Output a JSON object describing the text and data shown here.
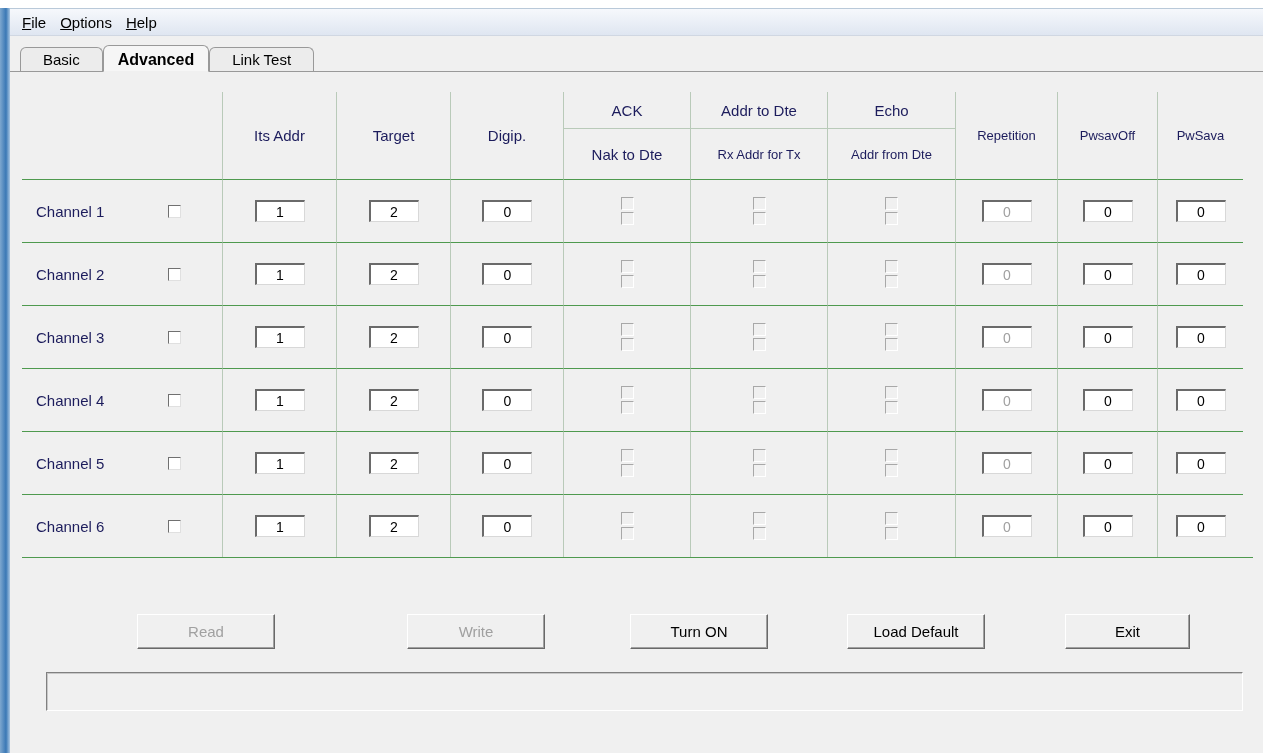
{
  "menu": [
    {
      "label": "File"
    },
    {
      "label": "Options"
    },
    {
      "label": "Help"
    }
  ],
  "tabs": [
    {
      "label": "Basic",
      "selected": false
    },
    {
      "label": "Advanced",
      "selected": true
    },
    {
      "label": "Link Test",
      "selected": false
    }
  ],
  "columns": [
    {
      "kind": "field",
      "label": "Its Addr",
      "disabled": false
    },
    {
      "kind": "field",
      "label": "Target",
      "disabled": false
    },
    {
      "kind": "field",
      "label": "Digip.",
      "disabled": false
    },
    {
      "kind": "checks",
      "label": "ACK",
      "sublabel": "Nak to Dte",
      "disabled": true
    },
    {
      "kind": "checks",
      "label": "Addr to Dte",
      "sublabel": "Rx Addr for Tx",
      "disabled": true
    },
    {
      "kind": "checks",
      "label": "Echo",
      "sublabel": "Addr from Dte",
      "disabled": true
    },
    {
      "kind": "field",
      "label": "Repetition",
      "disabled": true
    },
    {
      "kind": "field",
      "label": "PwsavOff",
      "disabled": false
    },
    {
      "kind": "field",
      "label": "PwSava",
      "disabled": false
    }
  ],
  "rows": [
    {
      "label": "Channel 1",
      "checked": false,
      "cells": [
        {
          "value": "1"
        },
        {
          "value": "2"
        },
        {
          "value": "0"
        },
        {
          "top": false,
          "bottom": false
        },
        {
          "top": false,
          "bottom": false
        },
        {
          "top": false,
          "bottom": false
        },
        {
          "value": "0"
        },
        {
          "value": "0"
        },
        {
          "value": "0"
        }
      ]
    },
    {
      "label": "Channel 2",
      "checked": false,
      "cells": [
        {
          "value": "1"
        },
        {
          "value": "2"
        },
        {
          "value": "0"
        },
        {
          "top": false,
          "bottom": false
        },
        {
          "top": false,
          "bottom": false
        },
        {
          "top": false,
          "bottom": false
        },
        {
          "value": "0"
        },
        {
          "value": "0"
        },
        {
          "value": "0"
        }
      ]
    },
    {
      "label": "Channel 3",
      "checked": false,
      "cells": [
        {
          "value": "1"
        },
        {
          "value": "2"
        },
        {
          "value": "0"
        },
        {
          "top": false,
          "bottom": false
        },
        {
          "top": false,
          "bottom": false
        },
        {
          "top": false,
          "bottom": false
        },
        {
          "value": "0"
        },
        {
          "value": "0"
        },
        {
          "value": "0"
        }
      ]
    },
    {
      "label": "Channel 4",
      "checked": false,
      "cells": [
        {
          "value": "1"
        },
        {
          "value": "2"
        },
        {
          "value": "0"
        },
        {
          "top": false,
          "bottom": false
        },
        {
          "top": false,
          "bottom": false
        },
        {
          "top": false,
          "bottom": false
        },
        {
          "value": "0"
        },
        {
          "value": "0"
        },
        {
          "value": "0"
        }
      ]
    },
    {
      "label": "Channel 5",
      "checked": false,
      "cells": [
        {
          "value": "1"
        },
        {
          "value": "2"
        },
        {
          "value": "0"
        },
        {
          "top": false,
          "bottom": false
        },
        {
          "top": false,
          "bottom": false
        },
        {
          "top": false,
          "bottom": false
        },
        {
          "value": "0"
        },
        {
          "value": "0"
        },
        {
          "value": "0"
        }
      ]
    },
    {
      "label": "Channel 6",
      "checked": false,
      "cells": [
        {
          "value": "1"
        },
        {
          "value": "2"
        },
        {
          "value": "0"
        },
        {
          "top": false,
          "bottom": false
        },
        {
          "top": false,
          "bottom": false
        },
        {
          "top": false,
          "bottom": false
        },
        {
          "value": "0"
        },
        {
          "value": "0"
        },
        {
          "value": "0"
        }
      ]
    }
  ],
  "buttons": [
    {
      "label": "Read",
      "disabled": true
    },
    {
      "label": "Write",
      "disabled": true
    },
    {
      "label": "Turn ON",
      "disabled": false
    },
    {
      "label": "Load Default",
      "disabled": false
    },
    {
      "label": "Exit",
      "disabled": false
    }
  ],
  "status_bar": {
    "kind": "empty"
  }
}
